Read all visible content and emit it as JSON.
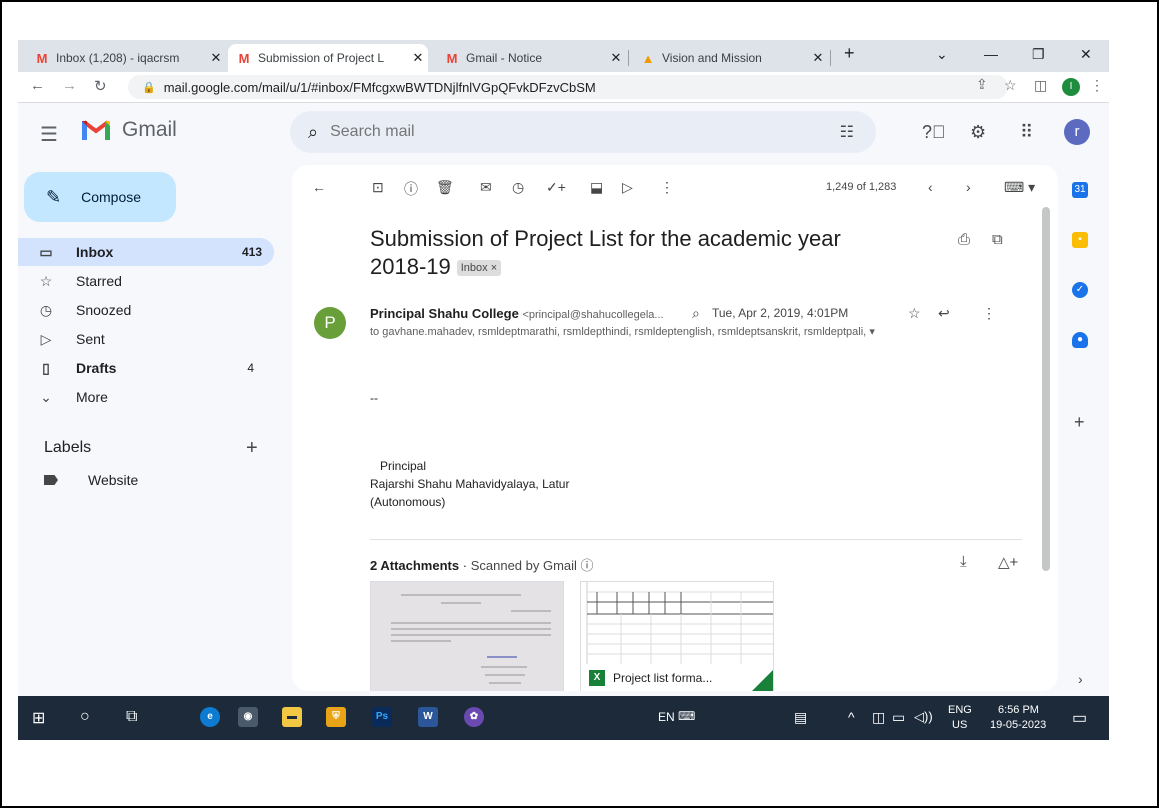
{
  "browser": {
    "tabs": [
      {
        "label": "Inbox (1,208) - iqacrsm",
        "close": "✕",
        "favicon": "M"
      },
      {
        "label": "Submission of Project L",
        "close": "✕",
        "favicon": "M"
      },
      {
        "label": "Gmail - Notice",
        "close": "✕",
        "favicon": "M"
      },
      {
        "label": "Vision and Mission",
        "close": "✕",
        "favicon": "▲"
      }
    ],
    "new_tab": "+",
    "url": "mail.google.com/mail/u/1/#inbox/FMfcgxwBWTDNjlfnlVGpQFvkDFzvCbSM",
    "profile_initial": "I"
  },
  "gmail": {
    "app_name": "Gmail",
    "search_placeholder": "Search mail",
    "account_initial": "r",
    "compose_label": "Compose",
    "nav": [
      {
        "label": "Inbox",
        "count": "413",
        "icon": "inbox-icon",
        "active": true
      },
      {
        "label": "Starred",
        "count": "",
        "icon": "star-icon"
      },
      {
        "label": "Snoozed",
        "count": "",
        "icon": "clock-icon"
      },
      {
        "label": "Sent",
        "count": "",
        "icon": "send-icon"
      },
      {
        "label": "Drafts",
        "count": "4",
        "icon": "draft-icon"
      },
      {
        "label": "More",
        "count": "",
        "icon": "chevron-down-icon"
      }
    ],
    "labels_heading": "Labels",
    "labels": [
      {
        "label": "Website"
      }
    ],
    "toolbar": {
      "message_count": "1,249 of 1,283"
    },
    "email": {
      "subject_line1": "Submission of Project List for the academic year",
      "subject_line2": "2018-19",
      "inbox_chip": "Inbox ×",
      "sender_initial": "P",
      "sender_name": "Principal Shahu College",
      "sender_email": "<principal@shahucollegela...",
      "date": "Tue, Apr 2, 2019, 4:01PM",
      "recipients": "to gavhane.mahadev, rsmldeptmarathi, rsmldepthindi, rsmldeptenglish, rsmldeptsanskrit, rsmldeptpali,",
      "body_dash": "--",
      "signature": [
        "Principal",
        "Rajarshi Shahu Mahavidyalaya, Latur",
        "(Autonomous)"
      ],
      "attachments_heading": "2 Attachments",
      "attachments_dot": "·",
      "attachments_scanned": "Scanned by Gmail ⓘ",
      "attachment_2_name": "Project list forma..."
    }
  },
  "taskbar": {
    "lang_indicator": "EN",
    "lang_top": "ENG",
    "lang_bottom": "US",
    "time": "6:56 PM",
    "date": "19-05-2023",
    "ps_label": "Ps",
    "word_label": "W"
  },
  "colors": {
    "compose_bg": "#c2e7ff",
    "inbox_active_bg": "#d3e3fd",
    "sender_avatar": "#689f38",
    "taskbar_bg": "#1c2a3a",
    "gmail_red": "#ea4335"
  }
}
